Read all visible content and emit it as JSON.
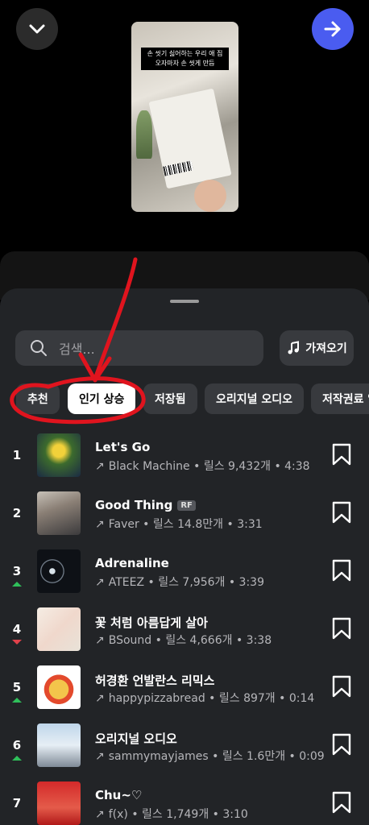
{
  "preview": {
    "caption": "손 씻기 싫어하는 우리 애 집 오자마자 손 씻게 만듬"
  },
  "search": {
    "placeholder": "검색..."
  },
  "import_label": "가져오기",
  "tabs": [
    {
      "label": "추천"
    },
    {
      "label": "인기 상승"
    },
    {
      "label": "저장됨"
    },
    {
      "label": "오리지널 오디오"
    },
    {
      "label": "저작권료 없음"
    }
  ],
  "tracks": [
    {
      "rank": "1",
      "title": "Let's Go",
      "badge": "",
      "meta": "Black Machine • 릴스 9,432개 • 4:38",
      "trend": "none"
    },
    {
      "rank": "2",
      "title": "Good Thing",
      "badge": "RF",
      "meta": "Faver • 릴스 14.8만개 • 3:31",
      "trend": "none"
    },
    {
      "rank": "3",
      "title": "Adrenaline",
      "badge": "",
      "meta": "ATEEZ • 릴스 7,956개 • 3:39",
      "trend": "up"
    },
    {
      "rank": "4",
      "title": "꽃 처럼 아름답게 살아",
      "badge": "",
      "meta": "BSound • 릴스 4,666개 • 3:38",
      "trend": "down"
    },
    {
      "rank": "5",
      "title": "허경환 언발란스 리믹스",
      "badge": "",
      "meta": "happypizzabread • 릴스 897개 • 0:14",
      "trend": "up"
    },
    {
      "rank": "6",
      "title": "오리지널 오디오",
      "badge": "",
      "meta": "sammymayjames • 릴스 1.6만개 • 0:09",
      "trend": "up"
    },
    {
      "rank": "7",
      "title": "Chu~♡",
      "badge": "",
      "meta": "f(x) • 릴스 1,749개 • 3:10",
      "trend": "none"
    }
  ],
  "colors": {
    "accent": "#4a5cf0",
    "annotation": "#e0141e",
    "trend_up": "#2fbf5a",
    "trend_down": "#e0414a"
  },
  "icons": {
    "down": "chevron-down-icon",
    "next": "arrow-right-icon",
    "search": "search-icon",
    "import": "music-note-icon",
    "save": "bookmark-icon",
    "trend": "trending-arrow-icon"
  }
}
